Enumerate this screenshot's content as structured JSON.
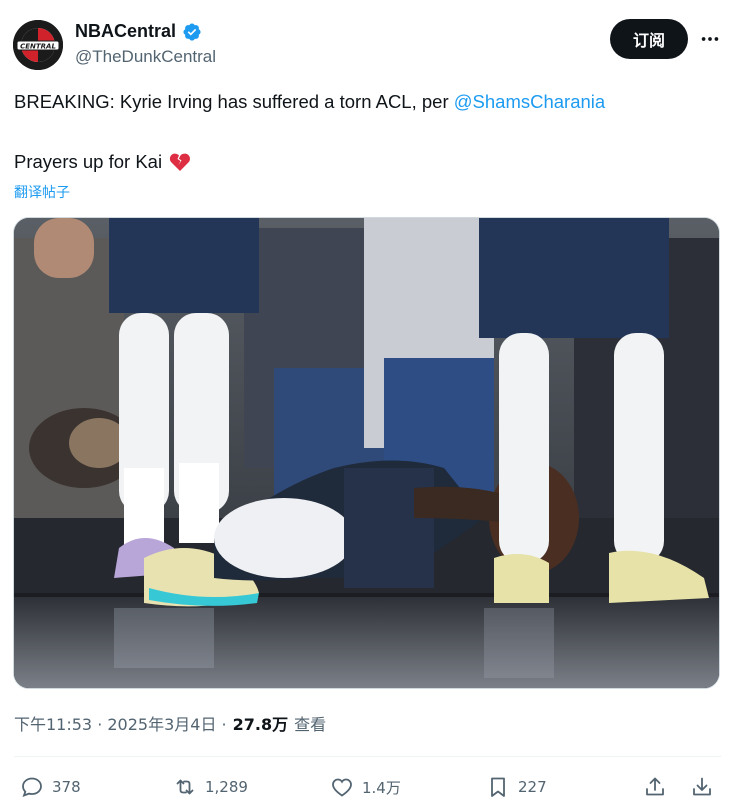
{
  "author": {
    "display_name": "NBACentral",
    "handle": "@TheDunkCentral",
    "avatar_text": "CENTRAL"
  },
  "header": {
    "subscribe_label": "订阅",
    "more_icon": "more-horizontal-icon"
  },
  "tweet": {
    "line1_text": "BREAKING: Kyrie Irving has suffered a torn ACL, per ",
    "line1_mention": "@ShamsCharania",
    "line2_text": "Prayers up for Kai",
    "line2_emoji": "broken-heart-icon",
    "translate_label": "翻译帖子"
  },
  "media": {
    "description_icon": "photo"
  },
  "meta": {
    "timestamp": "下午11:53 · 2025年3月4日 · ",
    "views_count": "27.8万",
    "views_label": "查看"
  },
  "actions": {
    "reply_count": "378",
    "repost_count": "1,289",
    "like_count": "1.4万",
    "bookmark_count": "227"
  },
  "colors": {
    "accent": "#1d9bf0",
    "text": "#0f1419",
    "muted": "#536471"
  }
}
